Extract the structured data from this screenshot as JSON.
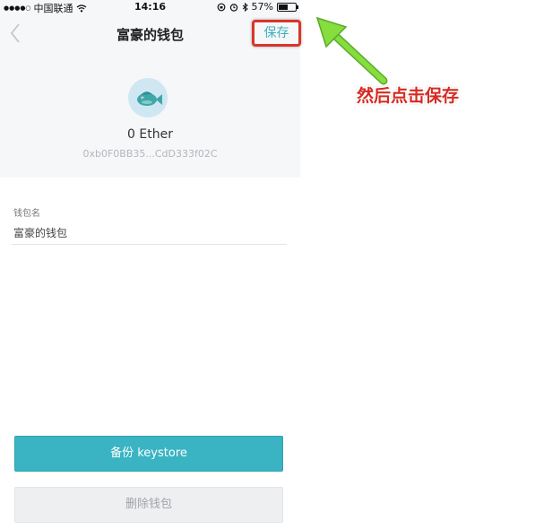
{
  "status_bar": {
    "signal_dots": "●●●●○",
    "carrier": "中国联通",
    "time": "14:16",
    "battery": "57%",
    "battery_level": 0.57
  },
  "nav": {
    "title": "富豪的钱包",
    "save_label": "保存"
  },
  "wallet": {
    "balance": "0 Ether",
    "address": "0xb0F0BB35...CdD333f02C"
  },
  "form": {
    "name_label": "钱包名",
    "name_value": "富豪的钱包"
  },
  "buttons": {
    "backup_label": "备份 keystore",
    "delete_label": "删除钱包"
  },
  "annotation": {
    "text": "然后点击保存",
    "color": "#d52b22"
  },
  "colors": {
    "accent": "#3ab4c3",
    "highlight_box": "#d9352b",
    "arrow": "#7fd43a"
  }
}
